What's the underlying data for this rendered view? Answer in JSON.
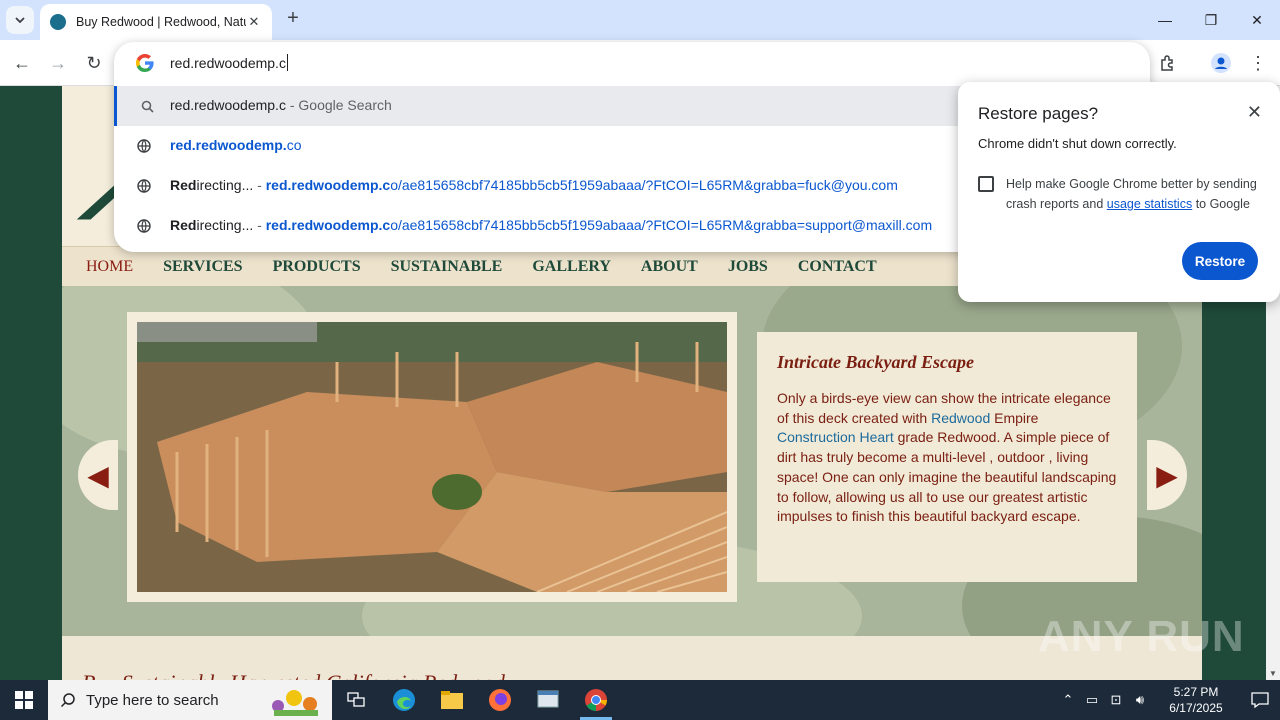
{
  "browser": {
    "tab": {
      "title": "Buy Redwood | Redwood, Natu"
    },
    "omnibox": {
      "typed_text": "red.redwoodemp.c",
      "suggestions": [
        {
          "icon": "search-icon",
          "text_main": "red.redwoodemp.c",
          "text_suffix": " - Google Search"
        },
        {
          "icon": "globe-icon",
          "text_bold": "red.redwoodemp.",
          "text_rest": "co"
        },
        {
          "icon": "globe-icon",
          "title_bold": "Red",
          "title_rest": "irecting...",
          "sep": " - ",
          "url_bold": "red.redwoodemp.c",
          "url_rest": "o/ae815658cbf74185bb5cb5f1959abaaa/?FtCOI=L65RM&grabba=fuck@you.com"
        },
        {
          "icon": "globe-icon",
          "title_bold": "Red",
          "title_rest": "irecting...",
          "sep": " - ",
          "url_bold": "red.redwoodemp.c",
          "url_rest": "o/ae815658cbf74185bb5cb5f1959abaaa/?FtCOI=L65RM&grabba=support@maxill.com"
        }
      ]
    },
    "restore_bubble": {
      "title": "Restore pages?",
      "subtitle": "Chrome didn't shut down correctly.",
      "checkbox_text_1": "Help make Google Chrome better by sending crash reports and ",
      "checkbox_link": "usage statistics",
      "checkbox_text_2": " to Google",
      "button_label": "Restore"
    }
  },
  "site": {
    "nav": [
      "HOME",
      "SERVICES",
      "PRODUCTS",
      "SUSTAINABLE",
      "GALLERY",
      "ABOUT",
      "JOBS",
      "CONTACT"
    ],
    "slide": {
      "title": "Intricate Backyard Escape",
      "p1": "Only a birds-eye view can show the intricate elegance of this deck created with ",
      "link1": "Redwood",
      "p2": " Empire ",
      "link2": "Construction Heart",
      "p3": " grade Redwood. A simple piece of dirt has truly become a multi-level , outdoor , living space! One can only imagine the beautiful landscaping to follow, allowing us all to use our greatest artistic impulses to finish this beautiful backyard escape."
    },
    "below_heading": "Buy Sustainably Harvested California Redwood"
  },
  "watermark": "ANY RUN",
  "taskbar": {
    "search_placeholder": "Type here to search",
    "time": "5:27 PM",
    "date": "6/17/2025"
  }
}
